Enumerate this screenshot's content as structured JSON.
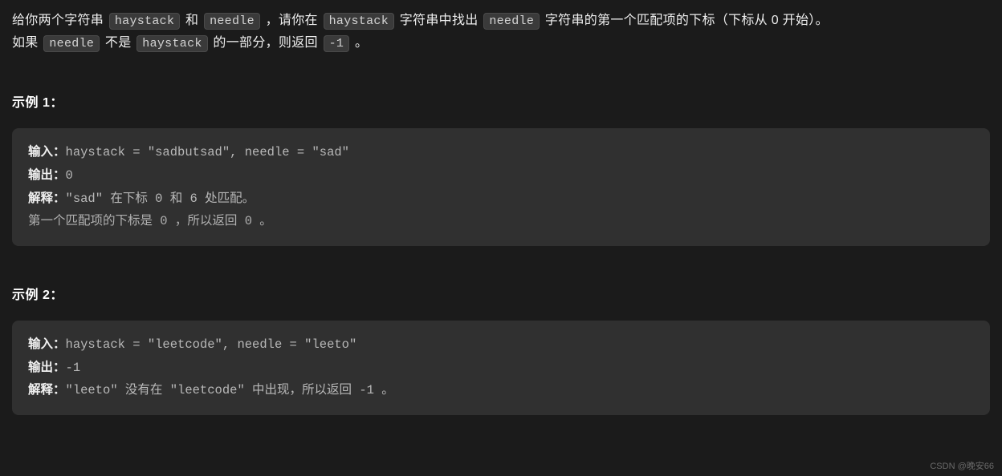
{
  "description": {
    "line1_parts": {
      "p1": "给你两个字符串 ",
      "c1": "haystack",
      "p2": " 和 ",
      "c2": "needle",
      "p3": " ，请你在 ",
      "c3": "haystack",
      "p4": " 字符串中找出 ",
      "c4": "needle",
      "p5": " 字符串的第一个匹配项的下标（下标从 0 开始）。"
    },
    "line2_parts": {
      "p1": "如果 ",
      "c1": "needle",
      "p2": " 不是 ",
      "c2": "haystack",
      "p3": " 的一部分，则返回  ",
      "c3": "-1",
      "p4": " 。"
    }
  },
  "examples": [
    {
      "heading": "示例 1：",
      "input_label": "输入：",
      "input_value": "haystack = \"sadbutsad\", needle = \"sad\"",
      "output_label": "输出：",
      "output_value": "0",
      "explain_label": "解释：",
      "explain_value": "\"sad\" 在下标 0 和 6 处匹配。",
      "explain_line2": "第一个匹配项的下标是 0 ，所以返回 0 。"
    },
    {
      "heading": "示例 2：",
      "input_label": "输入：",
      "input_value": "haystack = \"leetcode\", needle = \"leeto\"",
      "output_label": "输出：",
      "output_value": "-1",
      "explain_label": "解释：",
      "explain_value": "\"leeto\" 没有在 \"leetcode\" 中出现，所以返回 -1 。"
    }
  ],
  "watermark": "CSDN @晚安66"
}
